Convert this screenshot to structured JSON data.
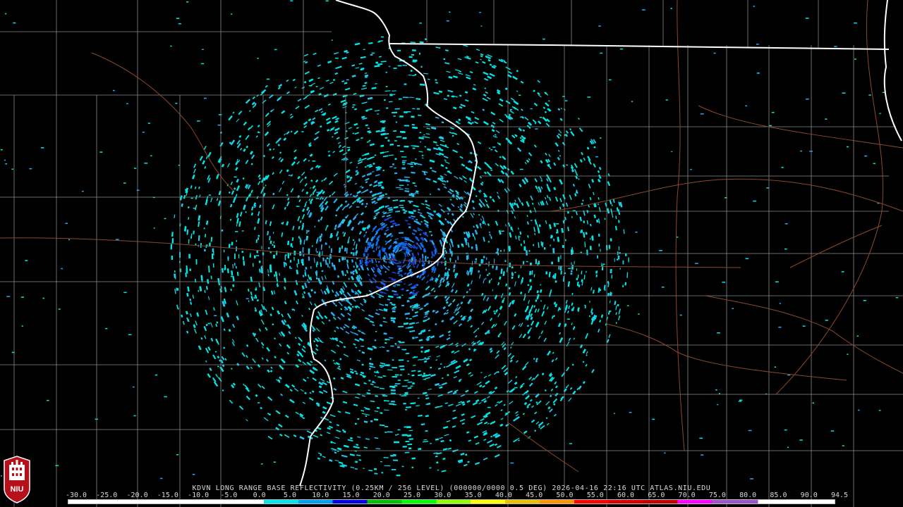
{
  "title": "KDVN LONG RANGE BASE REFLECTIVITY (0.25KM / 256 LEVEL) (000000/0000 0.5 DEG) 2026-04-16 22:16 UTC  ATLAS.NIU.EDU",
  "logo_text": "NIU",
  "scale": {
    "ticks": [
      "-30.0",
      "-25.0",
      "-20.0",
      "-15.0",
      "-10.0",
      "-5.0",
      "0.0",
      "5.0",
      "10.0",
      "15.0",
      "20.0",
      "25.0",
      "30.0",
      "35.0",
      "40.0",
      "45.0",
      "50.0",
      "55.0",
      "60.0",
      "65.0",
      "70.0",
      "75.0",
      "80.0",
      "85.0",
      "90.0",
      "94.5"
    ],
    "colors": {
      "lt_0": "#ffffff",
      "0_5": "#00e5e5",
      "5_10": "#00a0f0",
      "10_15": "#0000e0",
      "15_20": "#00c000",
      "20_25": "#00ff00",
      "25_30": "#90ff00",
      "30_35": "#ffff00",
      "35_40": "#e7c000",
      "40_45": "#ff9000",
      "45_50": "#ff0000",
      "50_55": "#d60000",
      "55_60": "#c00000",
      "60_65": "#ff00ff",
      "65_70": "#9955c9",
      "gt_70": "#ffffff"
    }
  },
  "map": {
    "background": "#000000",
    "county_line_color": "#8a8a8a",
    "state_line_color": "#ffffff",
    "road_color": "#8b4a2b",
    "echo_colors": [
      "#00e5e5",
      "#1fc9e8",
      "#2aa8f0",
      "#0f6fe8",
      "#1d3fd8"
    ]
  }
}
